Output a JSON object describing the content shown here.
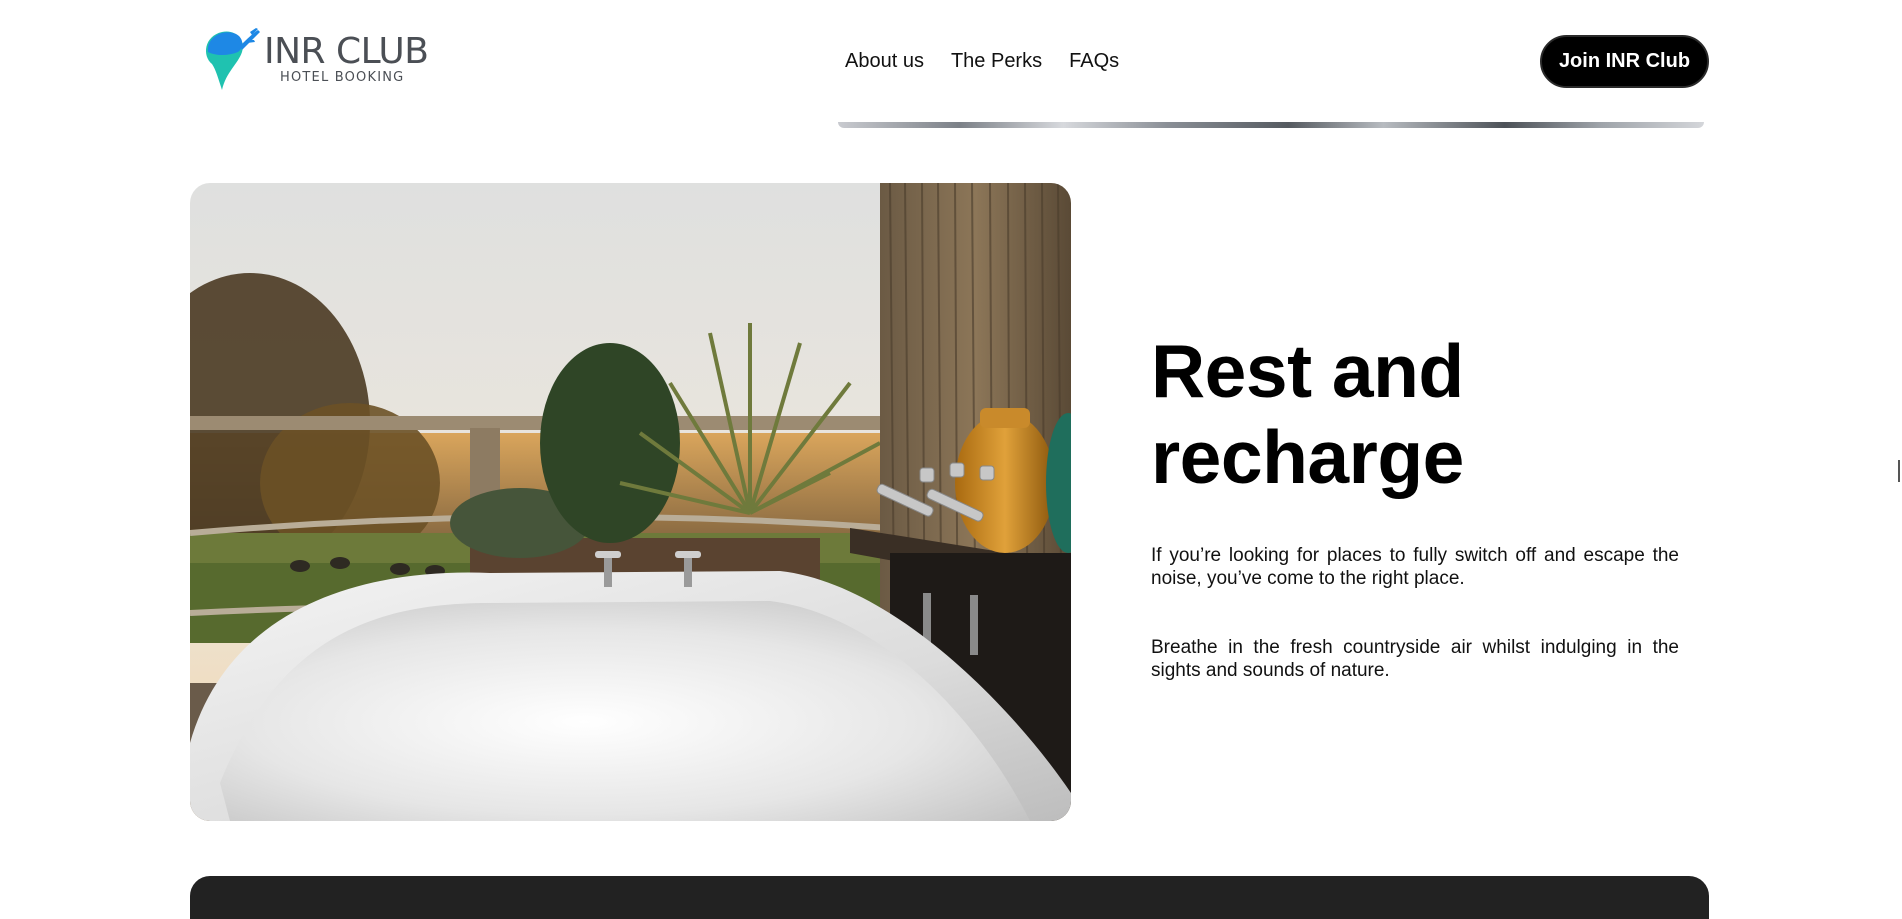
{
  "brand": {
    "name": "INR CLUB",
    "tagline": "HOTEL BOOKING",
    "colors": {
      "pin_blue": "#1e88e5",
      "pin_teal": "#1fc2b0",
      "text": "#4b4f55"
    }
  },
  "nav": {
    "items": [
      {
        "label": "About us"
      },
      {
        "label": "The Perks"
      },
      {
        "label": "FAQs"
      }
    ]
  },
  "cta": {
    "label": "Join INR Club",
    "bg": "#000000"
  },
  "feature": {
    "image_icon": "outdoor-bathtub-photo",
    "headline": "Rest and recharge",
    "paragraphs": [
      "If you’re looking for places to fully switch off and escape the noise, you’ve come to the right place.",
      "Breathe in the fresh countryside air whilst indulging in the sights and sounds of nature."
    ]
  },
  "footer_band": {
    "color": "#222222"
  }
}
